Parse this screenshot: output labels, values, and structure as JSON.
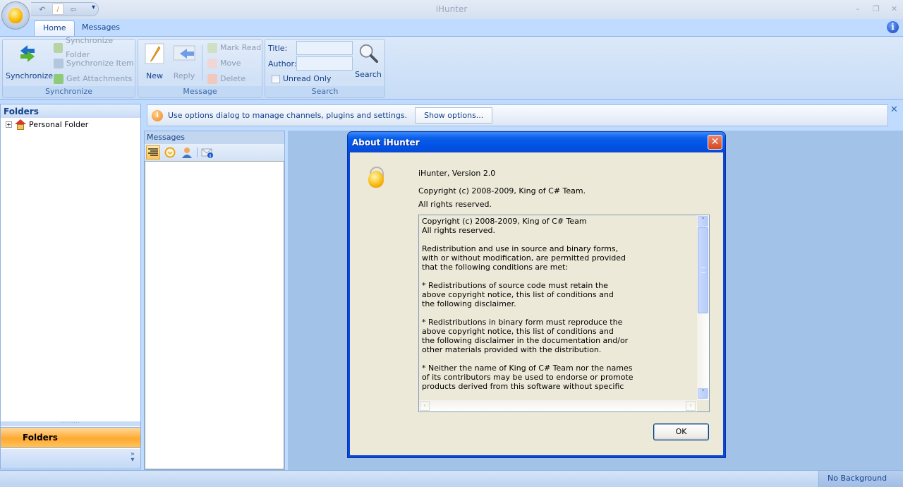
{
  "window": {
    "title": "iHunter",
    "controls": {
      "minimize": "–",
      "maximize": "❐",
      "close": "✕"
    }
  },
  "quick_access": {
    "items": [
      {
        "name": "undo-icon",
        "glyph": "↶"
      },
      {
        "name": "new-icon",
        "glyph": "/"
      },
      {
        "name": "reply-icon",
        "glyph": "⇦"
      }
    ],
    "more_glyph": "▾"
  },
  "tabs": [
    {
      "label": "Home",
      "active": true
    },
    {
      "label": "Messages",
      "active": false
    }
  ],
  "help_glyph": "i",
  "ribbon": {
    "synchronize_group": {
      "label": "Synchronize",
      "big_button": "Synchronize",
      "small_buttons": [
        "Synchronize Folder",
        "Synchronize Item",
        "Get Attachments"
      ]
    },
    "message_group": {
      "label": "Message",
      "new_button": "New",
      "reply_button": "Reply",
      "small_buttons": [
        "Mark Read",
        "Move",
        "Delete"
      ]
    },
    "search_group": {
      "label": "Search",
      "title_label": "Title:",
      "title_value": "",
      "author_label": "Author:",
      "author_value": "",
      "unread_only_label": "Unread Only",
      "unread_only_checked": false,
      "search_button": "Search"
    }
  },
  "folders_pane": {
    "header": "Folders",
    "tree": [
      {
        "label": "Personal Folder",
        "expander": "+"
      }
    ],
    "grip": "·········",
    "nav_button": "Folders",
    "chevron": "»"
  },
  "infobar": {
    "icon": "i",
    "message": "Use options dialog to manage channels, plugins and settings.",
    "button": "Show options...",
    "close_glyph": "✕"
  },
  "messages_panel": {
    "header": "Messages",
    "toolbar": [
      "list-view",
      "clock",
      "contact",
      "mail-info"
    ]
  },
  "status_bar": {
    "task": "No Background Task"
  },
  "about_dialog": {
    "title": "About iHunter",
    "close_glyph": "✕",
    "version": "iHunter, Version 2.0",
    "copyright": "Copyright (c) 2008-2009, King of C# Team.",
    "rights": "All rights reserved.",
    "license_text": "Copyright (c) 2008-2009, King of C# Team\nAll rights reserved.\n\nRedistribution and use in source and binary forms,\nwith or without modification, are permitted provided\nthat the following conditions are met:\n\n* Redistributions of source code must retain the\nabove copyright notice, this list of conditions and\nthe following disclaimer.\n\n* Redistributions in binary form must reproduce the\nabove copyright notice, this list of conditions and\nthe following disclaimer in the documentation and/or\nother materials provided with the distribution.\n\n* Neither the name of King of C# Team nor the names\nof its contributors may be used to endorse or promote\nproducts derived from this software without specific",
    "scroll_up": "˄",
    "scroll_down": "˅",
    "scroll_left": "‹",
    "scroll_right": "›",
    "ok_button": "OK"
  }
}
